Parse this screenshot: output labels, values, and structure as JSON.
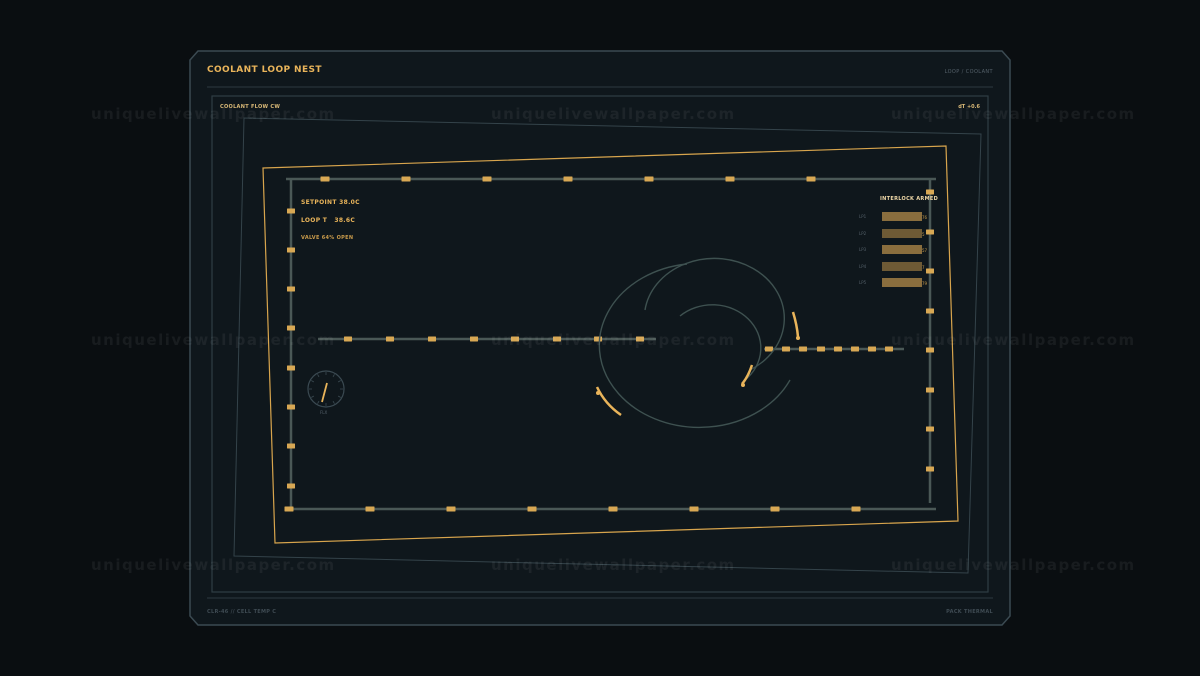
{
  "header": {
    "title": "COOLANT LOOP NEST",
    "breadcrumb": "LOOP / COOLANT"
  },
  "panel": {
    "flow_label": "COOLANT FLOW CW",
    "delta_label": "dT +0.6"
  },
  "readouts": {
    "setpoint": "SETPOINT 38.0C",
    "loop_t": "LOOP T   38.6C",
    "valve": "VALVE 64% OPEN"
  },
  "interlock": {
    "title": "INTERLOCK ARMED",
    "items": [
      {
        "label": "LP1",
        "value": "76",
        "level": 0.96
      },
      {
        "label": "LP2",
        "value": "5",
        "level": 0.96
      },
      {
        "label": "LP3",
        "value": "57",
        "level": 0.96
      },
      {
        "label": "LP4",
        "value": "7",
        "level": 0.96
      },
      {
        "label": "LP5",
        "value": "79",
        "level": 0.96
      }
    ]
  },
  "dial": {
    "label": "FLX"
  },
  "footer": {
    "left": "CLR-46 // CELL TEMP C",
    "right": "PACK THERMAL"
  },
  "watermark": "uniquelivewallpaper.com",
  "colors": {
    "background": "#0a0e11",
    "panel": "#0f171c",
    "accent": "#e9b45a",
    "frame": "#3b4a52",
    "pipe": "#4a5856"
  }
}
